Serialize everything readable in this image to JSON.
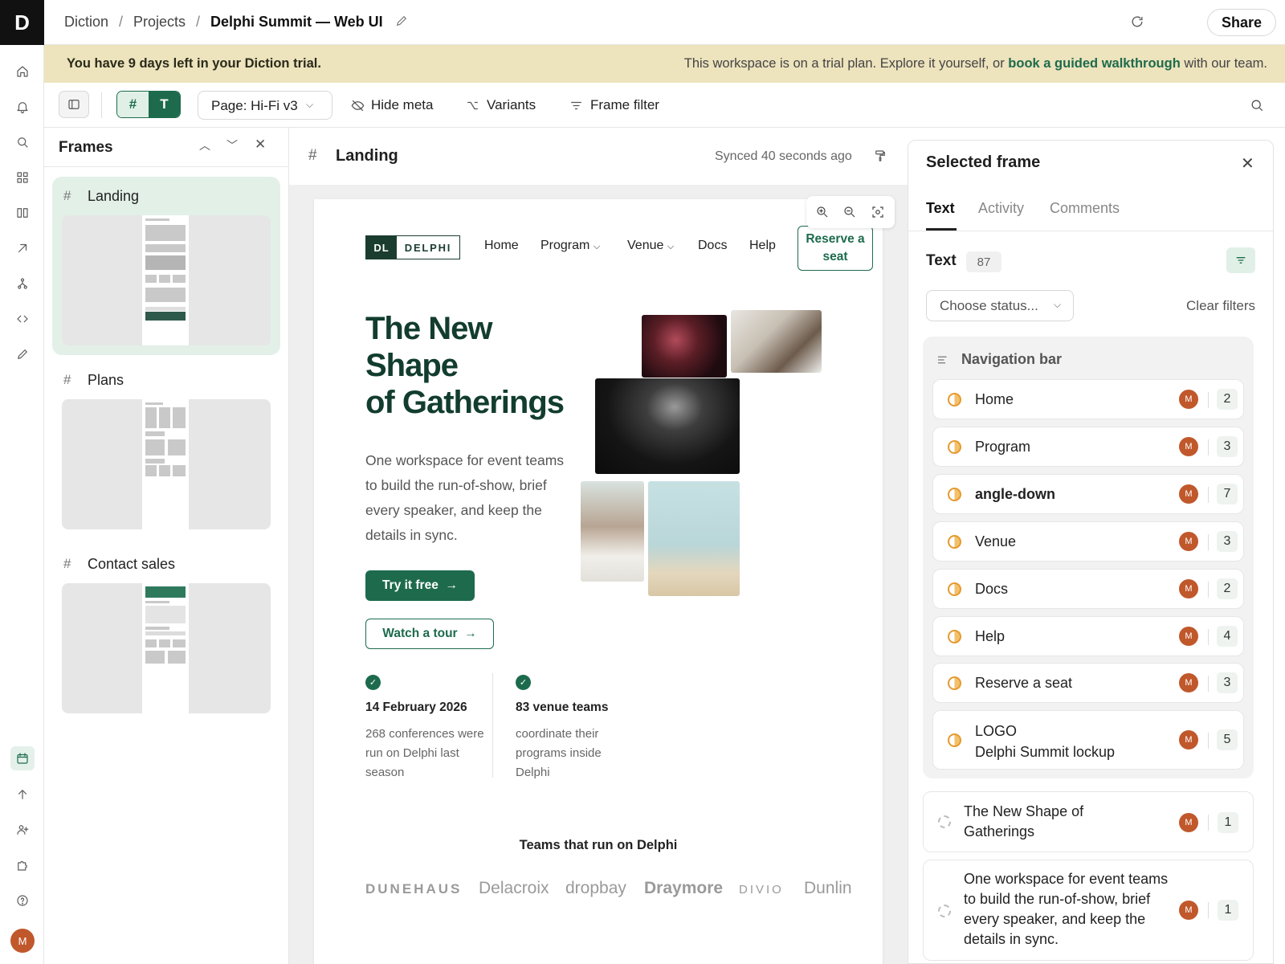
{
  "app": {
    "logo_letter": "D"
  },
  "breadcrumb": {
    "root": "Diction",
    "projects": "Projects",
    "current": "Delphi Summit — Web UI",
    "separator": "/"
  },
  "topbar": {
    "share_label": "Share"
  },
  "banner": {
    "left": "You have 9 days left in your Diction trial.",
    "right_prefix": "This workspace is on a trial plan. Explore it yourself, or ",
    "right_link": "book a guided walkthrough",
    "right_suffix": " with our team."
  },
  "toolbar": {
    "toggle_hash": "#",
    "toggle_text": "T",
    "page_select": "Page: Hi-Fi v3",
    "hide_meta": "Hide meta",
    "variants": "Variants",
    "frame_filter": "Frame filter"
  },
  "frames_panel": {
    "title": "Frames",
    "items": [
      {
        "label": "Landing"
      },
      {
        "label": "Plans"
      },
      {
        "label": "Contact sales"
      }
    ]
  },
  "canvas": {
    "frame_title": "Landing",
    "synced": "Synced 40 seconds ago"
  },
  "site": {
    "logo_mark": "DL",
    "logo_name": "DELPHI",
    "nav": [
      "Home",
      "Program",
      "Venue",
      "Docs",
      "Help"
    ],
    "reserve": "Reserve a seat",
    "hero_title_1": "The New",
    "hero_title_2": "Shape",
    "hero_title_3": "of Gatherings",
    "hero_body": "One workspace for event teams to build the run-of-show, brief every speaker, and keep the details in sync.",
    "try_btn": "Try it free",
    "tour_btn": "Watch a tour",
    "stats": [
      {
        "head": "14 February 2026",
        "body": "268 conferences were run on Delphi last season"
      },
      {
        "head": "83 venue teams",
        "body": "coordinate their programs inside Delphi"
      }
    ],
    "teams_heading": "Teams that run on Delphi",
    "brands": [
      "DUNEHAUS",
      "Delacroix",
      "dropbay",
      "Draymore",
      "DIVIO",
      "Dunlin"
    ]
  },
  "right_panel": {
    "title": "Selected frame",
    "tabs": [
      "Text",
      "Activity",
      "Comments"
    ],
    "text_heading": "Text",
    "text_count": "87",
    "status_placeholder": "Choose status...",
    "clear_filters": "Clear filters",
    "group_title": "Navigation bar",
    "group_rows": [
      {
        "label": "Home",
        "avatar": "M",
        "count": "2"
      },
      {
        "label": "Program",
        "avatar": "M",
        "count": "3"
      },
      {
        "label": "angle-down",
        "avatar": "M",
        "count": "7"
      },
      {
        "label": "Venue",
        "avatar": "M",
        "count": "3"
      },
      {
        "label": "Docs",
        "avatar": "M",
        "count": "2"
      },
      {
        "label": "Help",
        "avatar": "M",
        "count": "4"
      },
      {
        "label": "Reserve a seat",
        "avatar": "M",
        "count": "3"
      },
      {
        "label_1": "LOGO",
        "label_2": "Delphi Summit lockup",
        "avatar": "M",
        "count": "5"
      }
    ],
    "cards": [
      {
        "label": "The New Shape of Gatherings",
        "avatar": "M",
        "count": "1"
      },
      {
        "label": "One workspace for event teams to build the run-of-show, brief every speaker, and keep the details in sync.",
        "avatar": "M",
        "count": "1"
      }
    ]
  },
  "user": {
    "avatar": "M"
  },
  "colors": {
    "brand_green": "#1d6b4c",
    "banner_bg": "#ede3bd",
    "avatar_orange": "#c0582b"
  }
}
